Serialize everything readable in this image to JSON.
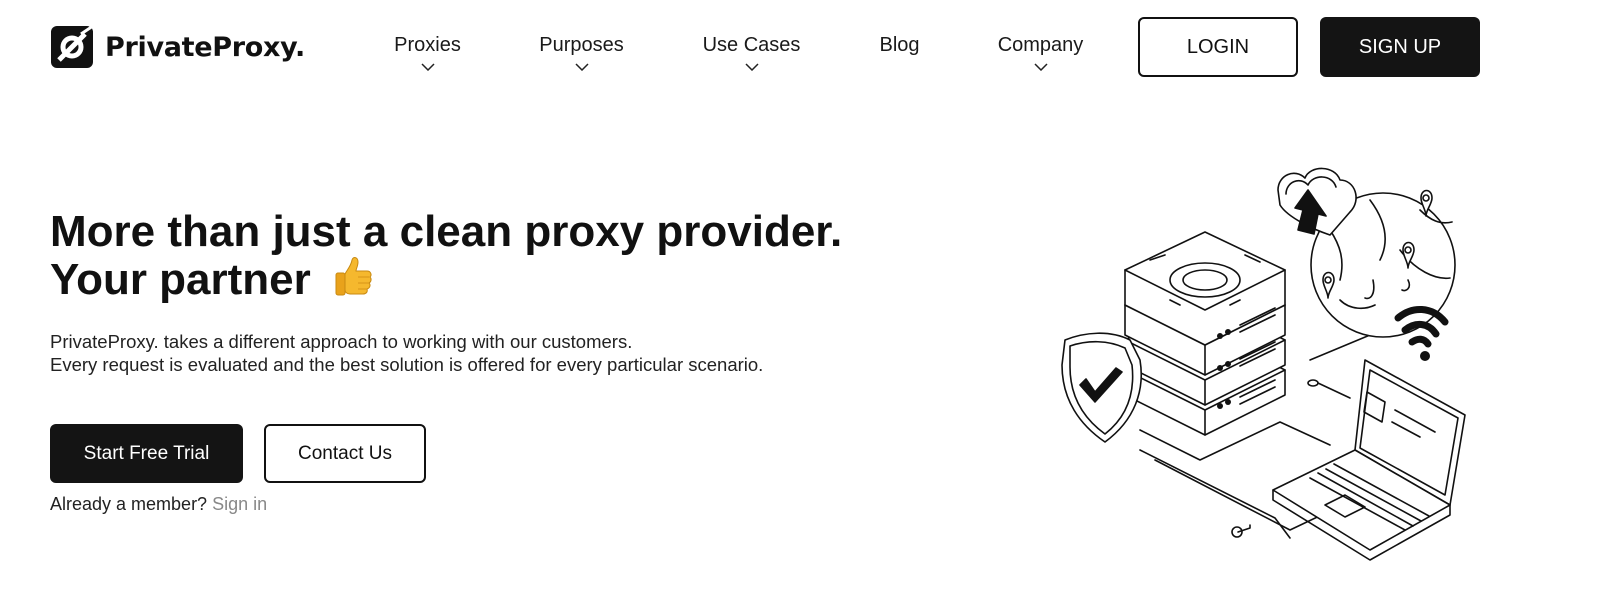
{
  "header": {
    "logo_text": "PrivateProxy.",
    "nav": [
      {
        "label": "Proxies",
        "has_dropdown": true
      },
      {
        "label": "Purposes",
        "has_dropdown": true
      },
      {
        "label": "Use Cases",
        "has_dropdown": true
      },
      {
        "label": "Blog",
        "has_dropdown": false
      },
      {
        "label": "Company",
        "has_dropdown": true
      }
    ],
    "login_label": "LOGIN",
    "signup_label": "SIGN UP"
  },
  "hero": {
    "title_line1": "More than just a clean proxy provider.",
    "title_line2": "Your partner",
    "title_emoji_icon": "thumbs-up-icon",
    "desc_line1": "PrivateProxy. takes a different approach to working with our customers.",
    "desc_line2": "Every request is evaluated and the best solution is offered for every particular scenario.",
    "primary_cta": "Start Free Trial",
    "secondary_cta": "Contact Us",
    "member_text": "Already a member?",
    "signin_link": "Sign in"
  },
  "colors": {
    "primary": "#141414",
    "background": "#ffffff",
    "muted_link": "#888888",
    "emoji_yellow": "#f5b82e"
  }
}
